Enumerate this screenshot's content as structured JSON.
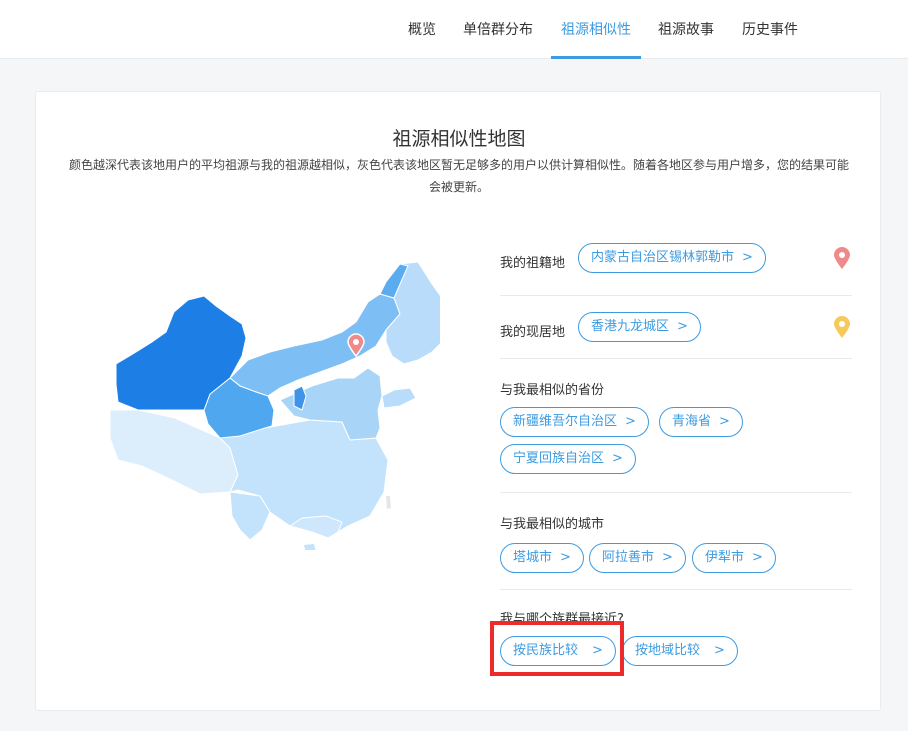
{
  "nav": {
    "tabs": [
      {
        "label": "概览"
      },
      {
        "label": "单倍群分布"
      },
      {
        "label": "祖源相似性",
        "active": true
      },
      {
        "label": "祖源故事"
      },
      {
        "label": "历史事件"
      }
    ]
  },
  "card": {
    "title": "祖源相似性地图",
    "description": "颜色越深代表该地用户的平均祖源与我的祖源越相似，灰色代表该地区暂无足够多的用户以供计算相似性。随着各地区参与用户增多，您的结果可能会被更新。"
  },
  "origin": {
    "label": "我的祖籍地",
    "value": "内蒙古自治区锡林郭勒市",
    "pin_color": "#f08a8a"
  },
  "residence": {
    "label": "我的现居地",
    "value": "香港九龙城区",
    "pin_color": "#f7c95a"
  },
  "similar_provinces": {
    "label": "与我最相似的省份",
    "items": [
      "新疆维吾尔自治区",
      "青海省",
      "宁夏回族自治区"
    ]
  },
  "similar_cities": {
    "label": "与我最相似的城市",
    "items": [
      "塔城市",
      "阿拉善市",
      "伊犁市"
    ]
  },
  "ethnic": {
    "label": "我与哪个族群最接近?",
    "by_ethnicity": "按民族比较",
    "by_region": "按地域比较"
  },
  "colors": {
    "accent": "#3d9be0",
    "highlight": "#ee2b2b",
    "map_darkest": "#1d7fe6",
    "map_dark": "#4fa7ef",
    "map_mid": "#8ec8f7",
    "map_light": "#c3e2fb",
    "map_lightest": "#dcedfc"
  }
}
